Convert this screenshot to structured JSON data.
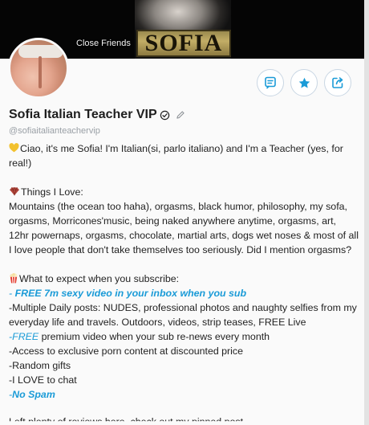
{
  "cover": {
    "sign_text": "SOFIA",
    "overlay_label": "Close Friends"
  },
  "profile": {
    "name": "Sofia Italian Teacher VIP",
    "handle": "@sofiaitalianteachervip"
  },
  "actions": {
    "message_icon": "message-icon",
    "favorite_icon": "star-icon",
    "share_icon": "share-icon"
  },
  "colors": {
    "accent_blue": "#1a9bd7",
    "button_border": "#c9d6e3"
  },
  "bio": {
    "intro": "Ciao, it's me Sofia! I'm Italian(si, parlo italiano) and I'm a Teacher (yes, for real!)",
    "things_heading": "Things I Love:",
    "things_body": "Mountains (the ocean too haha), orgasms, black humor, philosophy, my sofa, orgasms, Morricones'music, being naked anywhere anytime, orgasms, art, 12hr powernaps, orgasms, chocolate, martial arts, dogs wet noses & most of all I love people that don't take themselves too seriously. Did I mention orgasms?",
    "expect_heading": "What to expect when you subscribe:",
    "expect_items": {
      "free_video_prefix": "- ",
      "free_video": "FREE 7m sexy video in your inbox when you sub",
      "daily_posts": "-Multiple Daily posts: NUDES, professional photos and naughty selfies from my everyday life and travels. Outdoors, videos, strip teases, FREE Live",
      "free_premium_prefix": "-",
      "free_premium_word": "FREE",
      "free_premium_rest": " premium video when your sub re-news every month",
      "exclusive": "-Access to exclusive porn content at discounted price",
      "gifts": "-Random gifts",
      "chat": "-I LOVE to chat",
      "no_spam_prefix": "-",
      "no_spam": "No Spam"
    },
    "cutoff_line": "Left plenty of reviews here, check out my pinned post"
  }
}
